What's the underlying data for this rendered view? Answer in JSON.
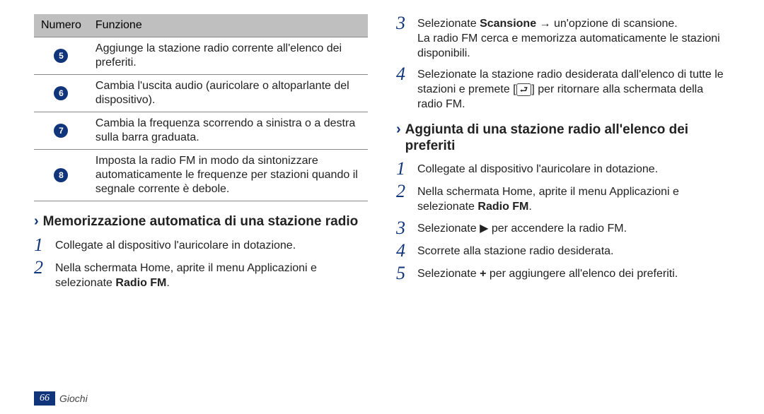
{
  "table": {
    "head_num": "Numero",
    "head_func": "Funzione",
    "rows": [
      {
        "n": "5",
        "t": "Aggiunge la stazione radio corrente all'elenco dei preferiti."
      },
      {
        "n": "6",
        "t": "Cambia l'uscita audio (auricolare o altoparlante del dispositivo)."
      },
      {
        "n": "7",
        "t": "Cambia la frequenza scorrendo a sinistra o a destra sulla barra graduata."
      },
      {
        "n": "8",
        "t": "Imposta la radio FM in modo da sintonizzare automaticamente le frequenze per stazioni quando il segnale corrente è debole."
      }
    ]
  },
  "memo_head": "Memorizzazione automatica di una stazione radio",
  "memo_steps": {
    "s1": "Collegate al dispositivo l'auricolare in dotazione.",
    "s2a": "Nella schermata Home, aprite il menu Applicazioni e selezionate ",
    "s2b": "Radio FM",
    "s2c": ".",
    "s3a": "Selezionate ",
    "s3b": "Scansione",
    "s3c": " → un'opzione di scansione.",
    "s3d": "La radio FM cerca e memorizza automaticamente le stazioni disponibili.",
    "s4a": "Selezionate la stazione radio desiderata dall'elenco di tutte le stazioni e premete [",
    "s4b": "] per ritornare alla schermata della radio FM."
  },
  "fav_head": "Aggiunta di una stazione radio all'elenco dei preferiti",
  "fav_steps": {
    "s1": "Collegate al dispositivo l'auricolare in dotazione.",
    "s2a": "Nella schermata Home, aprite il menu Applicazioni e selezionate ",
    "s2b": "Radio FM",
    "s2c": ".",
    "s3a": "Selezionate ",
    "s3b": " per accendere la radio FM.",
    "s4": "Scorrete alla stazione radio desiderata.",
    "s5a": "Selezionate ",
    "s5b": "+",
    "s5c": " per aggiungere all'elenco dei preferiti."
  },
  "footer": {
    "page": "66",
    "section": "Giochi"
  }
}
